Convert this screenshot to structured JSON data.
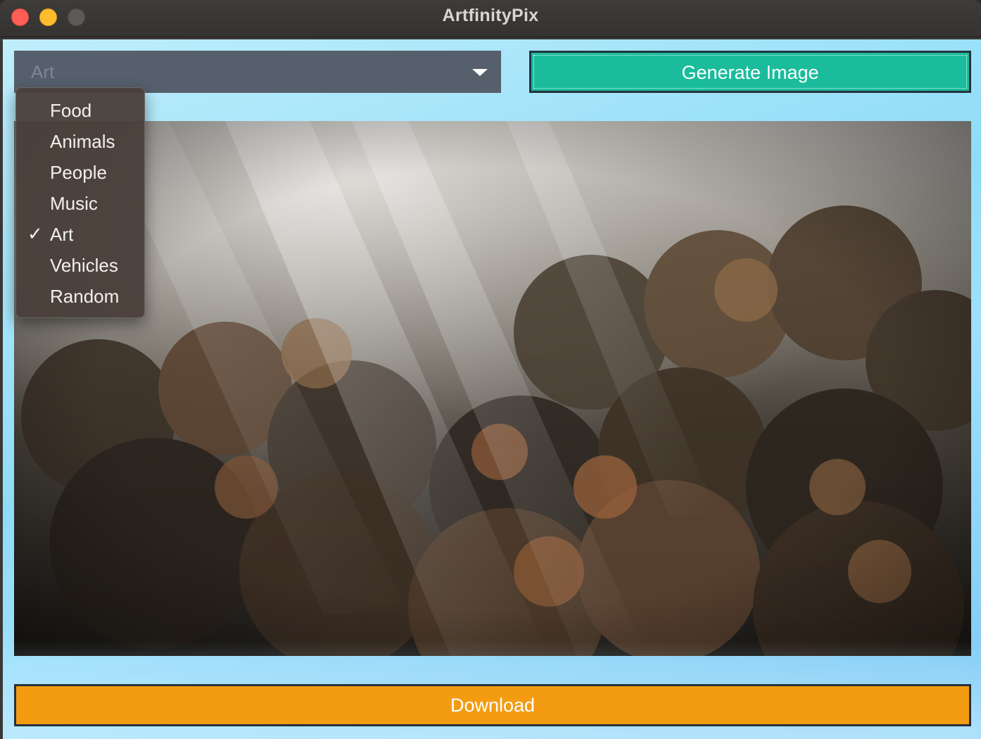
{
  "window": {
    "title": "ArtfinityPix",
    "controls": [
      "close-icon",
      "minimize-icon",
      "maximize-icon"
    ]
  },
  "category_select": {
    "selected_value": "Art",
    "arrow_icon": "chevron-down-icon"
  },
  "generate_button": {
    "label": "Generate Image",
    "color": "#1abc9c"
  },
  "category_menu": {
    "items": [
      {
        "label": "Food",
        "checked": false
      },
      {
        "label": "Animals",
        "checked": false
      },
      {
        "label": "People",
        "checked": false
      },
      {
        "label": "Music",
        "checked": false
      },
      {
        "label": "Art",
        "checked": true
      },
      {
        "label": "Vehicles",
        "checked": false
      },
      {
        "label": "Random",
        "checked": false
      }
    ],
    "check_glyph": "✓"
  },
  "download_button": {
    "label": "Download",
    "color": "#f39c12"
  },
  "colors": {
    "window_bg": "#3a3836",
    "client_bg": "#8fdcf7",
    "combo_bg": "#56606c"
  }
}
